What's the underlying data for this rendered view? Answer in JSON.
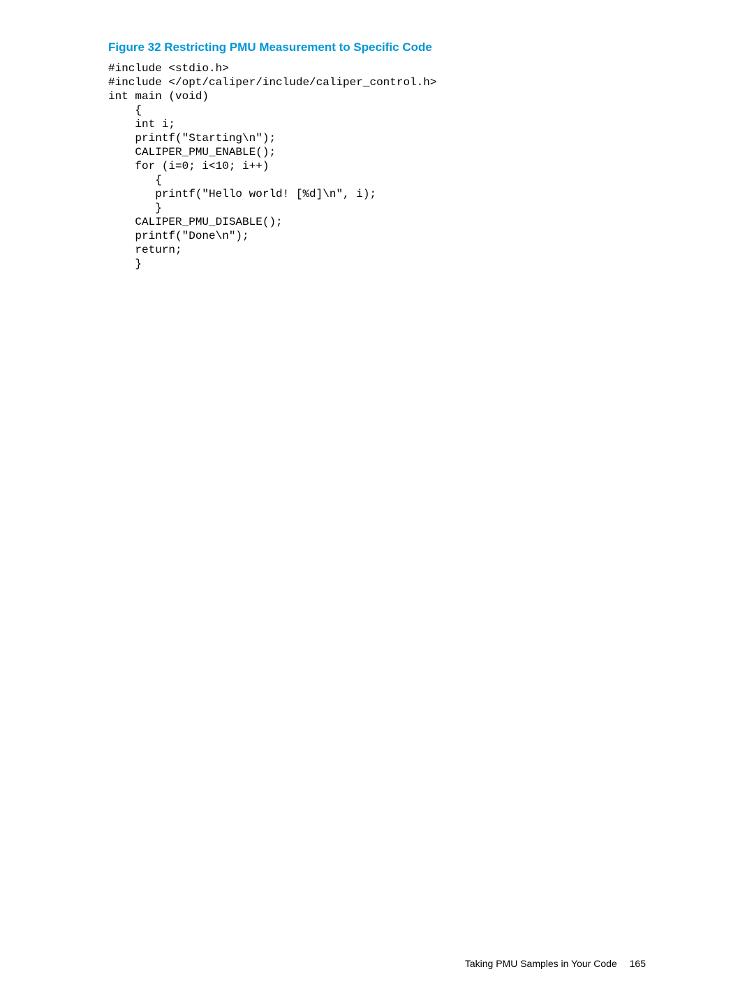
{
  "figure_caption": "Figure 32 Restricting PMU Measurement to Specific Code",
  "code_lines": [
    "#include <stdio.h>",
    "#include </opt/caliper/include/caliper_control.h>",
    "int main (void)",
    "    {",
    "    int i;",
    "    printf(\"Starting\\n\");",
    "    CALIPER_PMU_ENABLE();",
    "    for (i=0; i<10; i++)",
    "       {",
    "       printf(\"Hello world! [%d]\\n\", i);",
    "       }",
    "    CALIPER_PMU_DISABLE();",
    "    printf(\"Done\\n\");",
    "    return;",
    "    }"
  ],
  "footer_text": "Taking PMU Samples in Your Code",
  "page_number": "165"
}
